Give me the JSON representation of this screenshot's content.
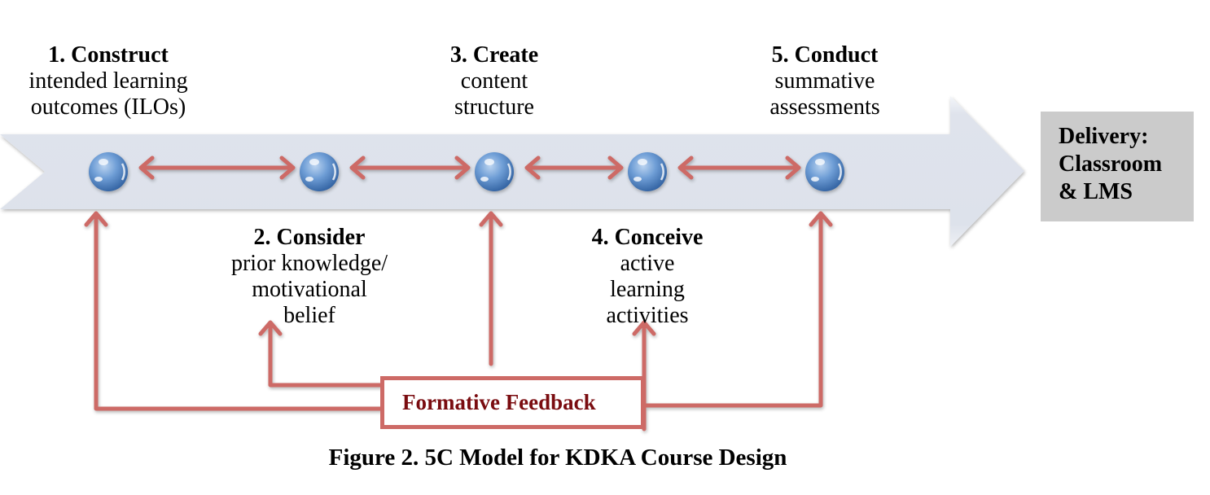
{
  "steps": [
    {
      "title": "1. Construct",
      "lines": [
        "intended learning",
        "outcomes (ILOs)"
      ]
    },
    {
      "title": "2. Consider",
      "lines": [
        "prior knowledge/",
        "motivational",
        "belief"
      ]
    },
    {
      "title": "3. Create",
      "lines": [
        "content",
        "structure"
      ]
    },
    {
      "title": "4. Conceive",
      "lines": [
        "active",
        "learning",
        "activities"
      ]
    },
    {
      "title": "5. Conduct",
      "lines": [
        "summative",
        "assessments"
      ]
    }
  ],
  "delivery": {
    "lines": [
      "Delivery:",
      "Classroom",
      "& LMS"
    ]
  },
  "feedback": {
    "label": "Formative Feedback"
  },
  "caption": "Figure 2. 5C Model for KDKA Course Design",
  "colors": {
    "arrow_red": "#cd6a66",
    "feedback_text": "#7a0c10",
    "delivery_bg": "#cbcbcb",
    "timeline_fill": "#e1e5ee",
    "sphere_blue": "#4a7fc0"
  }
}
